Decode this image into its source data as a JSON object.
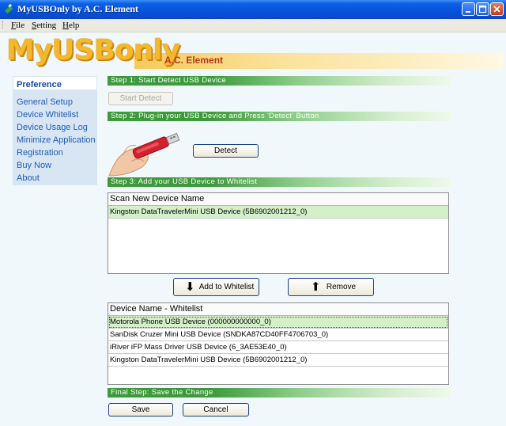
{
  "window": {
    "title": "MyUSBOnly by A.C. Element"
  },
  "menu": [
    "File",
    "Setting",
    "Help"
  ],
  "banner": {
    "logo_text": "MyUSBonly",
    "brand": "A.C. Element"
  },
  "sidebar": {
    "heading": "Preference",
    "items": [
      "General Setup",
      "Device Whitelist",
      "Device Usage Log",
      "Minimize Application",
      "Registration",
      "Buy Now",
      "About"
    ]
  },
  "steps": {
    "step1": "Step 1: Start Detect USB Device",
    "step2": "Step 2: Plug-in your USB Device and Press 'Detect' Button",
    "step3": "Step 3: Add your USB Device to Whitelist",
    "final": "Final Step: Save the Change"
  },
  "buttons": {
    "start_detect": "Start Detect",
    "detect": "Detect",
    "add": "Add to Whitelist",
    "remove": "Remove",
    "save": "Save",
    "cancel": "Cancel"
  },
  "scan_list": {
    "header": "Scan New Device Name",
    "rows": [
      "Kingston DataTravelerMini USB Device (5B6902001212_0)"
    ]
  },
  "whitelist": {
    "header": "Device Name - Whitelist",
    "rows": [
      "Motorola Phone USB Device (000000000000_0)",
      "SanDisk Cruzer Mini USB Device (SNDKA87CD40FF4706703_0)",
      "iRiver iFP Mass Driver USB Device (6_3AE53E40_0)",
      "Kingston DataTravelerMini USB Device (5B6902001212_0)"
    ]
  },
  "colors": {
    "title_bar": "#0a5fe6",
    "step_bar": "#3c9a3a",
    "selected_row": "#d4f0c8",
    "link": "#1f5bb8"
  }
}
